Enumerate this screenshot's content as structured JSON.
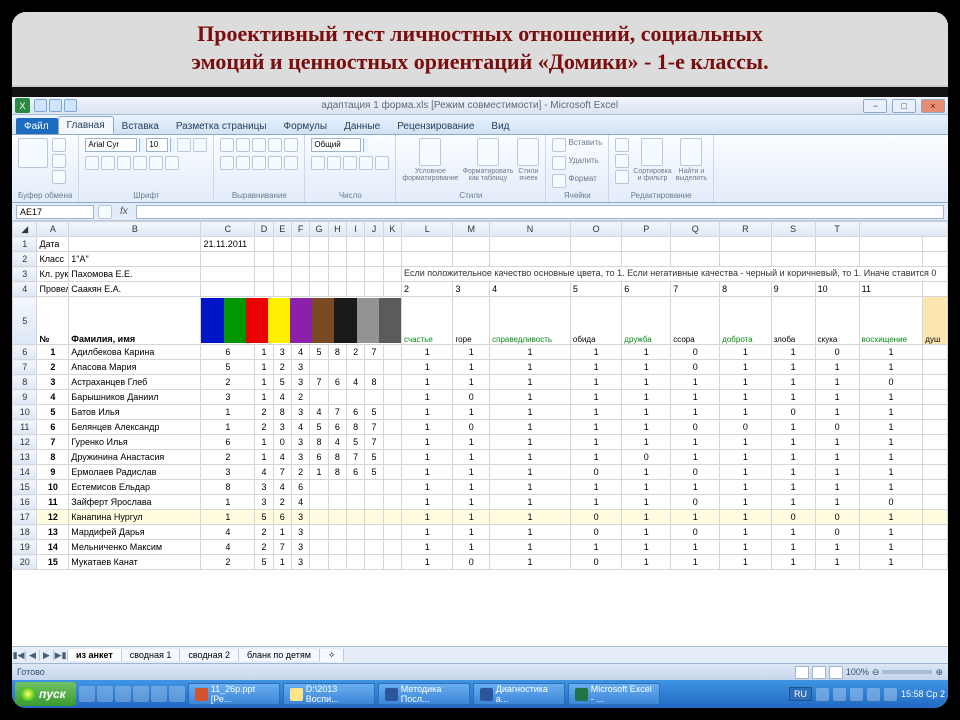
{
  "slide": {
    "title_line1": "Проективный тест личностных отношений, социальных",
    "title_line2": "эмоций и ценностных ориентаций «Домики» - 1-е классы."
  },
  "window": {
    "title": "адаптация 1 форма.xls [Режим совместимости] - Microsoft Excel"
  },
  "tabs": {
    "file": "Файл",
    "home": "Главная",
    "insert": "Вставка",
    "layout": "Разметка страницы",
    "formulas": "Формулы",
    "data": "Данные",
    "review": "Рецензирование",
    "view": "Вид"
  },
  "ribbon": {
    "clipboard": "Буфер обмена",
    "font_name": "Arial Cyr",
    "font_size": "10",
    "font_lbl": "Шрифт",
    "align_lbl": "Выравнивание",
    "number_fmt": "Общий",
    "number_lbl": "Число",
    "cond_fmt": "Условное\nформатирование",
    "fmt_table": "Форматировать\nкак таблицу",
    "cell_styles": "Стили\nячеек",
    "styles_lbl": "Стили",
    "insert_btn": "Вставить",
    "delete_btn": "Удалить",
    "format_btn": "Формат",
    "cells_lbl": "Ячейки",
    "sort": "Сортировка\nи фильтр",
    "find": "Найти и\nвыделить",
    "edit_lbl": "Редактирование"
  },
  "namebox": {
    "cell": "AE17"
  },
  "sheet": {
    "meta": {
      "date_lbl": "Дата",
      "date_val": "21.11.2011",
      "class_lbl": "Класс",
      "class_val": "1\"А\"",
      "teacher_lbl": "Кл. рук.",
      "teacher_val": "Пахомова Е.Е.",
      "conduct_lbl": "Провела",
      "conduct_val": "Саакян Е.А.",
      "note": "Если положительное качество основные цвета, то 1. Если негативные качества - черный и коричневый, то 1. Иначе ставится 0"
    },
    "header_row": {
      "num": "№",
      "name": "Фамилия, имя",
      "scale": [
        "2",
        "3",
        "4",
        "5",
        "6",
        "7",
        "8",
        "9",
        "10",
        "11"
      ],
      "labels": [
        "счастье",
        "горе",
        "справедливость",
        "обида",
        "дружба",
        "ссора",
        "доброта",
        "злоба",
        "скука",
        "восхищение",
        "душ"
      ]
    },
    "palette": [
      "#0015c7",
      "#029602",
      "#eb0000",
      "#ffef00",
      "#8b21aa",
      "#7a4a24",
      "#1a1a1a",
      "#939393",
      "#5b5b5b"
    ],
    "rows": [
      {
        "n": "1",
        "name": "Адилбекова Карина",
        "c": [
          6,
          1,
          3,
          4,
          5,
          8,
          2,
          7
        ],
        "s": [
          1,
          1,
          1,
          1,
          1,
          0,
          1,
          1,
          0,
          1
        ]
      },
      {
        "n": "2",
        "name": "Апасова  Мария",
        "c": [
          5,
          1,
          2,
          3,
          "",
          "",
          "",
          ""
        ],
        "s": [
          1,
          1,
          1,
          1,
          1,
          0,
          1,
          1,
          1,
          1
        ]
      },
      {
        "n": "3",
        "name": "Астраханцев Глеб",
        "c": [
          2,
          1,
          5,
          3,
          7,
          6,
          4,
          8
        ],
        "s": [
          1,
          1,
          1,
          1,
          1,
          1,
          1,
          1,
          1,
          0
        ]
      },
      {
        "n": "4",
        "name": "Барышников Даниил",
        "c": [
          3,
          1,
          4,
          2,
          "",
          "",
          "",
          ""
        ],
        "s": [
          1,
          0,
          1,
          1,
          1,
          1,
          1,
          1,
          1,
          1
        ]
      },
      {
        "n": "5",
        "name": "Батов Илья",
        "c": [
          1,
          2,
          8,
          3,
          4,
          7,
          6,
          5
        ],
        "s": [
          1,
          1,
          1,
          1,
          1,
          1,
          1,
          0,
          1,
          1
        ]
      },
      {
        "n": "6",
        "name": "Белянцев Александр",
        "c": [
          1,
          2,
          3,
          4,
          5,
          6,
          8,
          7
        ],
        "s": [
          1,
          0,
          1,
          1,
          1,
          0,
          0,
          1,
          0,
          1
        ]
      },
      {
        "n": "7",
        "name": "Гуренко Илья",
        "c": [
          6,
          1,
          0,
          3,
          8,
          4,
          5,
          7
        ],
        "s": [
          1,
          1,
          1,
          1,
          1,
          1,
          1,
          1,
          1,
          1
        ]
      },
      {
        "n": "8",
        "name": "Дружинина Анастасия",
        "c": [
          2,
          1,
          4,
          3,
          6,
          8,
          7,
          5
        ],
        "s": [
          1,
          1,
          1,
          1,
          0,
          1,
          1,
          1,
          1,
          1
        ]
      },
      {
        "n": "9",
        "name": "Ермолаев Радислав",
        "c": [
          3,
          4,
          7,
          2,
          1,
          8,
          6,
          5
        ],
        "s": [
          1,
          1,
          1,
          0,
          1,
          0,
          1,
          1,
          1,
          1
        ]
      },
      {
        "n": "10",
        "name": "Естемисов Ельдар",
        "c": [
          8,
          3,
          4,
          6,
          "",
          "",
          "",
          ""
        ],
        "s": [
          1,
          1,
          1,
          1,
          1,
          1,
          1,
          1,
          1,
          1
        ]
      },
      {
        "n": "11",
        "name": "Зайферт Ярослава",
        "c": [
          1,
          3,
          2,
          4,
          "",
          "",
          "",
          ""
        ],
        "s": [
          1,
          1,
          1,
          1,
          1,
          0,
          1,
          1,
          1,
          0
        ]
      },
      {
        "n": "12",
        "name": "Канапина Нургул",
        "c": [
          1,
          5,
          6,
          3,
          "",
          "",
          "",
          ""
        ],
        "s": [
          1,
          1,
          1,
          0,
          1,
          1,
          1,
          0,
          0,
          1
        ],
        "hl": true
      },
      {
        "n": "13",
        "name": "Мардифей Дарья",
        "c": [
          4,
          2,
          1,
          3,
          "",
          "",
          "",
          ""
        ],
        "s": [
          1,
          1,
          1,
          0,
          1,
          0,
          1,
          1,
          0,
          1
        ]
      },
      {
        "n": "14",
        "name": "Мельниченко Максим",
        "c": [
          4,
          2,
          7,
          3,
          "",
          "",
          "",
          ""
        ],
        "s": [
          1,
          1,
          1,
          1,
          1,
          1,
          1,
          1,
          1,
          1
        ]
      },
      {
        "n": "15",
        "name": "Мукатаев Канат",
        "c": [
          2,
          5,
          1,
          3,
          "",
          "",
          "",
          ""
        ],
        "s": [
          1,
          0,
          1,
          0,
          1,
          1,
          1,
          1,
          1,
          1
        ]
      }
    ]
  },
  "sheets": {
    "active": "из анкет",
    "s2": "сводная 1",
    "s3": "сводная 2",
    "s4": "бланк по детям"
  },
  "status": {
    "ready": "Готово",
    "zoom": "100%"
  },
  "taskbar": {
    "start": "пуск",
    "t1": "11_26p.ppt [Ре...",
    "t2": "D:\\2013 Воспи...",
    "t3": "Методика Посл...",
    "t4": "Диагностика а...",
    "t5": "Microsoft Excel - ...",
    "lang": "RU",
    "time": "15:58 Ср 2"
  }
}
